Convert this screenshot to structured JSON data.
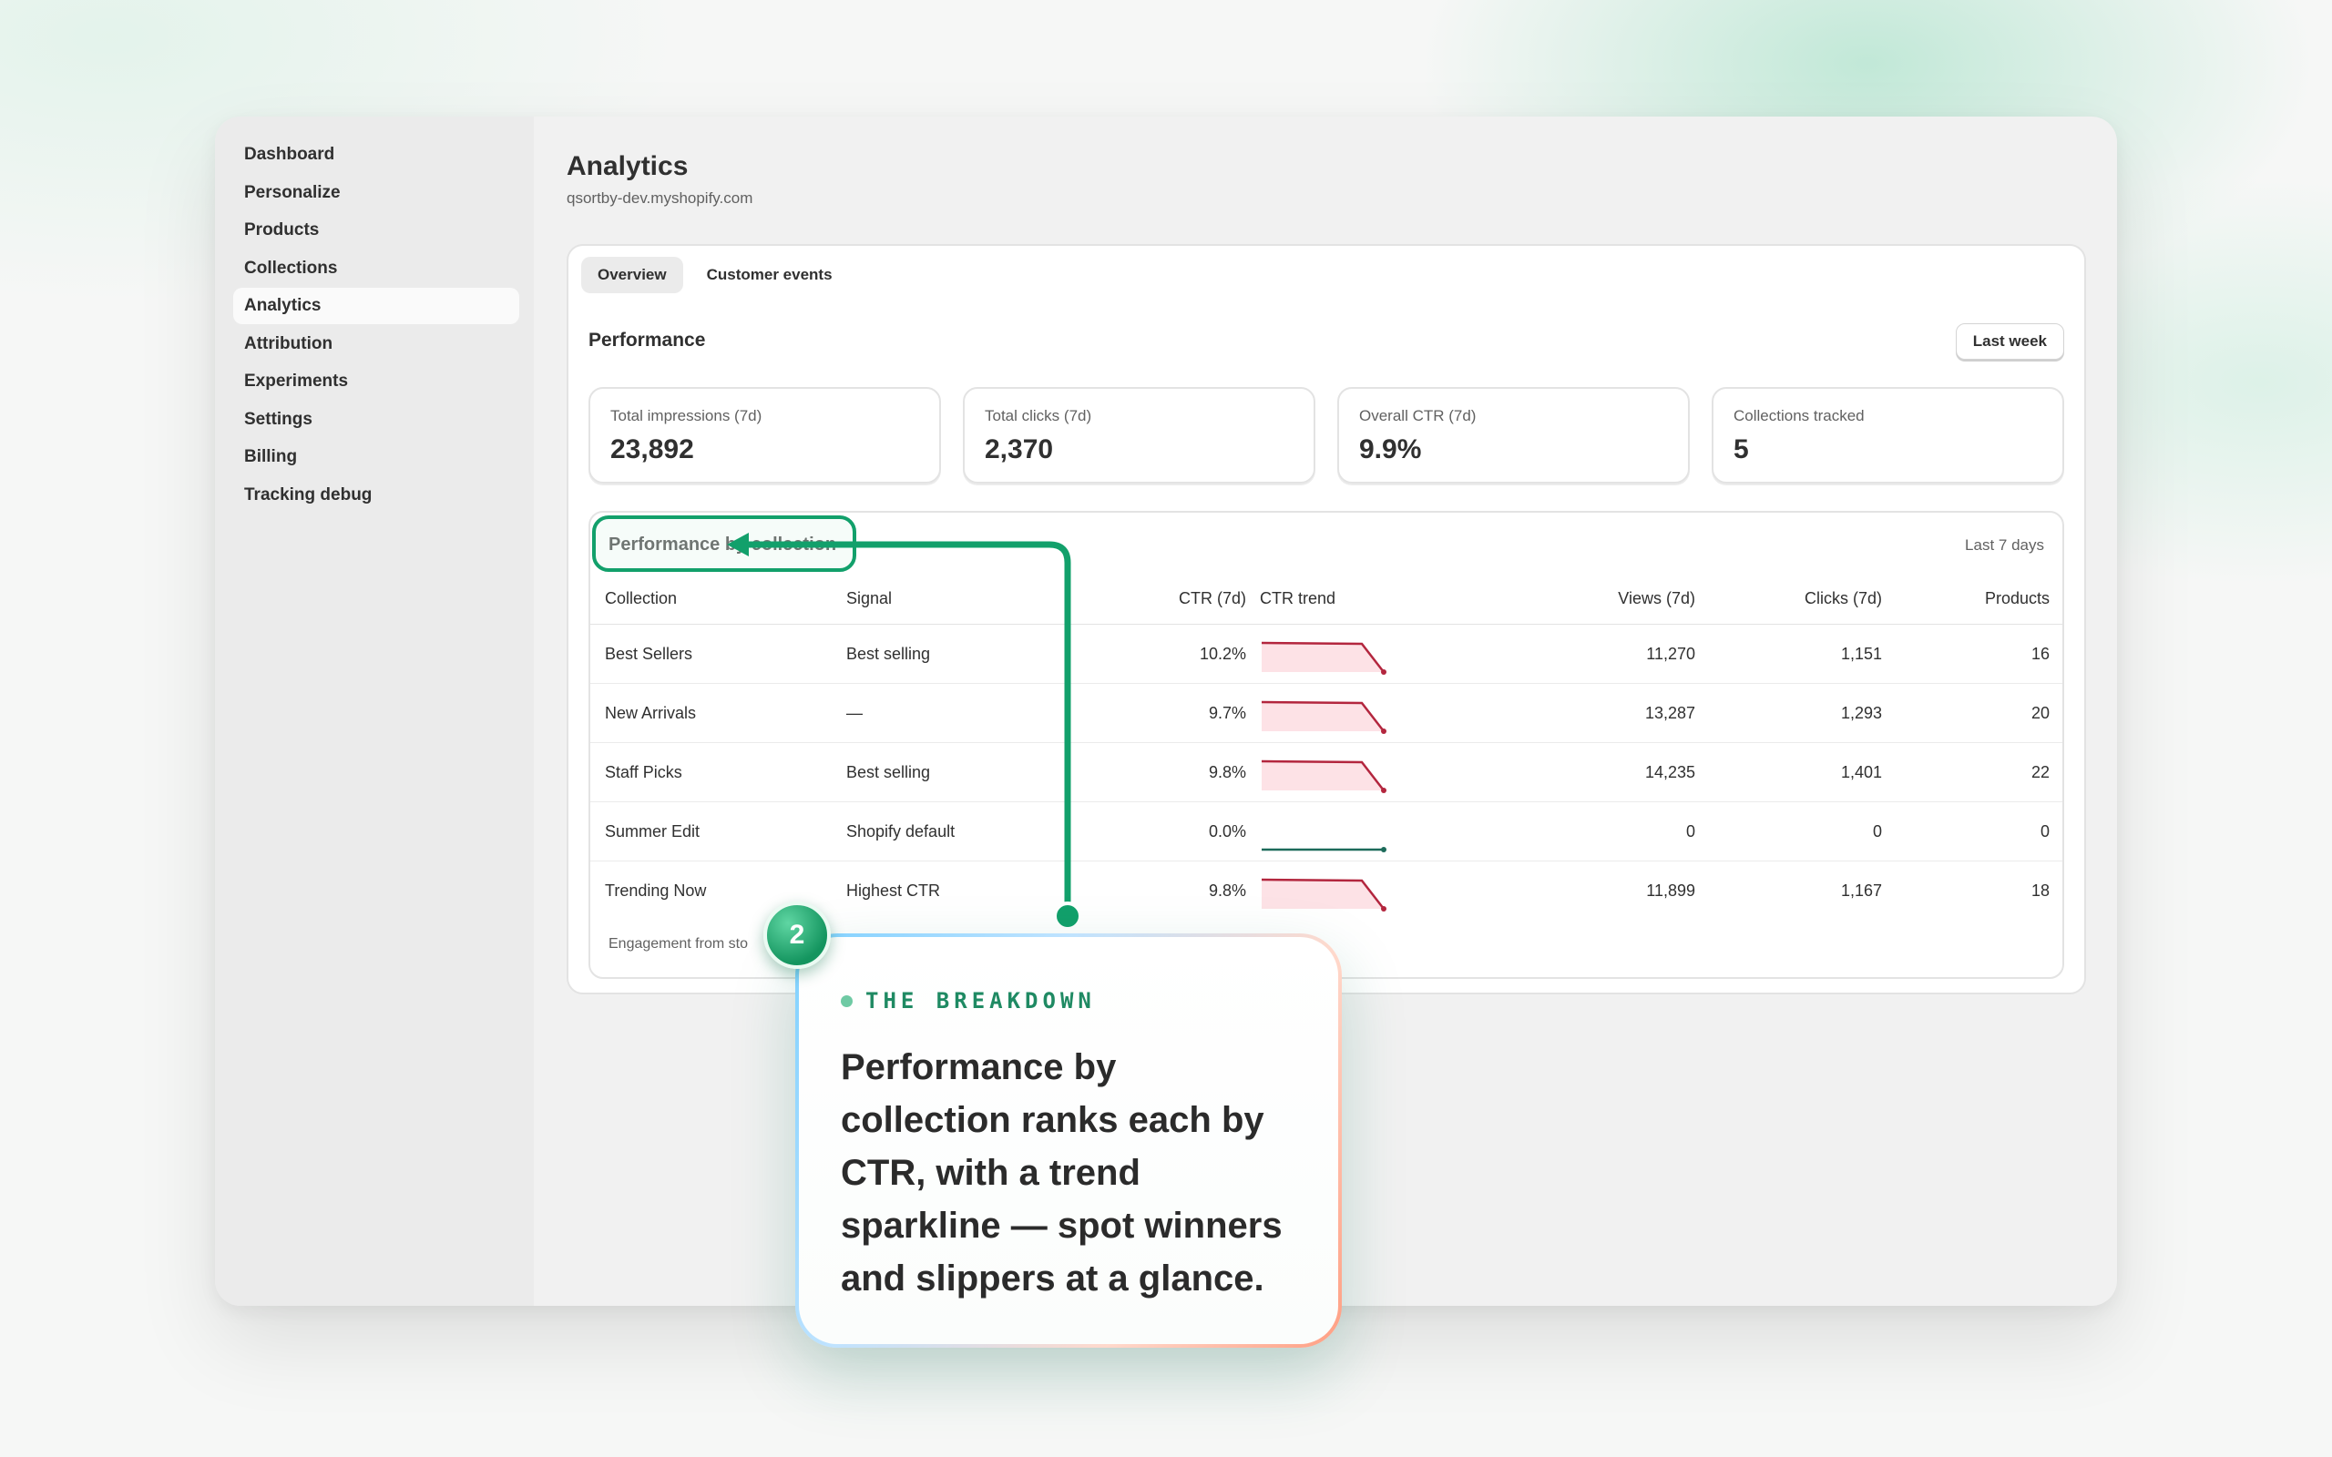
{
  "sidebar": {
    "items": [
      {
        "label": "Dashboard"
      },
      {
        "label": "Personalize"
      },
      {
        "label": "Products"
      },
      {
        "label": "Collections"
      },
      {
        "label": "Analytics",
        "active": true
      },
      {
        "label": "Attribution"
      },
      {
        "label": "Experiments"
      },
      {
        "label": "Settings"
      },
      {
        "label": "Billing"
      },
      {
        "label": "Tracking debug"
      }
    ]
  },
  "header": {
    "title": "Analytics",
    "subtitle": "qsortby-dev.myshopify.com"
  },
  "tabs": [
    {
      "label": "Overview",
      "active": true
    },
    {
      "label": "Customer events",
      "active": false
    }
  ],
  "performance": {
    "title": "Performance",
    "range_button": "Last week",
    "stats": [
      {
        "label": "Total impressions (7d)",
        "value": "23,892"
      },
      {
        "label": "Total clicks (7d)",
        "value": "2,370"
      },
      {
        "label": "Overall CTR (7d)",
        "value": "9.9%"
      },
      {
        "label": "Collections tracked",
        "value": "5"
      }
    ]
  },
  "by_collection": {
    "title": "Performance by collection",
    "range": "Last 7 days",
    "columns": {
      "collection": "Collection",
      "signal": "Signal",
      "ctr": "CTR (7d)",
      "trend": "CTR trend",
      "views": "Views (7d)",
      "clicks": "Clicks (7d)",
      "products": "Products"
    },
    "rows": [
      {
        "collection": "Best Sellers",
        "signal": "Best selling",
        "ctr": "10.2%",
        "views": "11,270",
        "clicks": "1,151",
        "products": "16",
        "trend": "down"
      },
      {
        "collection": "New Arrivals",
        "signal": "—",
        "ctr": "9.7%",
        "views": "13,287",
        "clicks": "1,293",
        "products": "20",
        "trend": "down"
      },
      {
        "collection": "Staff Picks",
        "signal": "Best selling",
        "ctr": "9.8%",
        "views": "14,235",
        "clicks": "1,401",
        "products": "22",
        "trend": "down"
      },
      {
        "collection": "Summer Edit",
        "signal": "Shopify default",
        "ctr": "0.0%",
        "views": "0",
        "clicks": "0",
        "products": "0",
        "trend": "flat"
      },
      {
        "collection": "Trending Now",
        "signal": "Highest CTR",
        "ctr": "9.8%",
        "views": "11,899",
        "clicks": "1,167",
        "products": "18",
        "trend": "down"
      }
    ],
    "footer": "Engagement from sto"
  },
  "callout": {
    "badge": "2",
    "eyebrow": "THE BREAKDOWN",
    "body": "Performance by collection ranks each by CTR, with a trend sparkline — spot winners and slippers at a glance."
  },
  "colors": {
    "accent": "#12a06b",
    "spark_down": "#b3263e",
    "spark_fill": "#fde2e6",
    "spark_flat": "#1d6b5a"
  }
}
